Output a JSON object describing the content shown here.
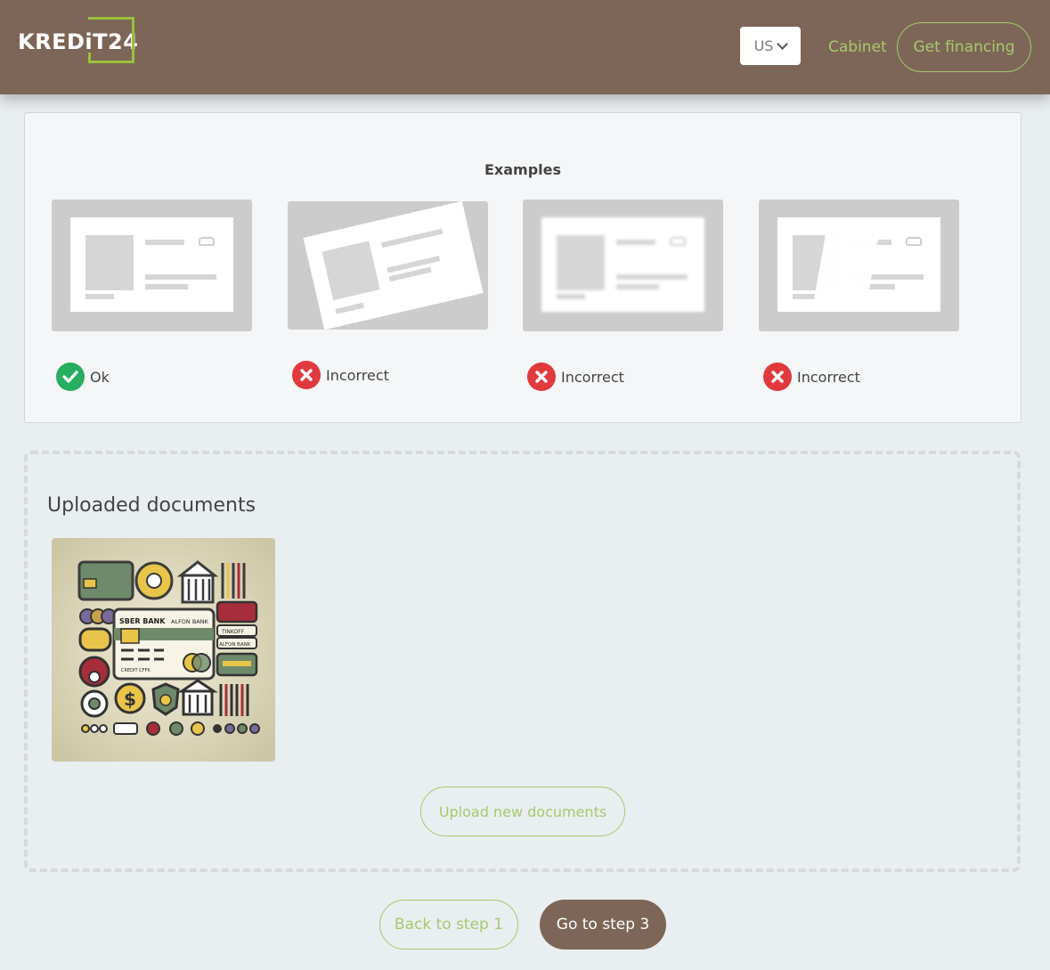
{
  "header": {
    "logo_text": "KREDiT24",
    "language": "US",
    "cabinet_label": "Cabinet",
    "financing_label": "Get financing"
  },
  "examples": {
    "title": "Examples",
    "items": [
      {
        "status": "ok",
        "label": "Ok"
      },
      {
        "status": "incorrect",
        "label": "Incorrect"
      },
      {
        "status": "incorrect",
        "label": "Incorrect"
      },
      {
        "status": "incorrect",
        "label": "Incorrect"
      }
    ]
  },
  "uploaded": {
    "title": "Uploaded documents",
    "thumbnail_texts": [
      "SBER BANK",
      "ALFON BANK",
      "TINKOFF",
      "ALFON BANK",
      "CREDIT CFFK"
    ],
    "upload_label": "Upload new documents"
  },
  "footer": {
    "back_label": "Back to step 1",
    "next_label": "Go to step 3"
  },
  "colors": {
    "brand_brown": "#7d6657",
    "accent_green": "#a7c96c",
    "ok_green": "#27ae60",
    "error_red": "#e0393e"
  }
}
